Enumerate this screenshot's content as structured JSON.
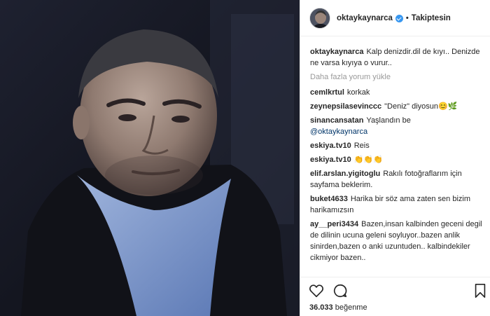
{
  "header": {
    "username": "oktaykaynarca",
    "separator": "•",
    "follow_status": "Takiptesin",
    "icons": {
      "verified": "verified-badge-icon"
    }
  },
  "caption": {
    "username": "oktaykaynarca",
    "text": "Kalp denizdir.dil de kıyı.. Denizde ne varsa kıyıya o vurur.."
  },
  "load_more": "Daha fazla yorum yükle",
  "comments": [
    {
      "username": "cemlkrtul",
      "text": "korkak"
    },
    {
      "username": "zeynepsilasevinccc",
      "text": "\"Deniz\" diyosun😊🌿"
    },
    {
      "username": "sinancansatan",
      "text": "Yaşlandın be",
      "mention": "@oktaykaynarca"
    },
    {
      "username": "eskiya.tv10",
      "text": "Reis"
    },
    {
      "username": "eskiya.tv10",
      "text": "👏👏👏"
    },
    {
      "username": "elif.arslan.yigitoglu",
      "text": "Rakılı fotoğraflarım için sayfama beklerim."
    },
    {
      "username": "buket4633",
      "text": "Harika bir söz ama zaten sen bizim harikamızsın"
    },
    {
      "username": "ay__peri3434",
      "text": "Bazen,insan kalbinden geceni degil de dilinin ucuna geleni soyluyor..bazen anlik sinirden,bazen o anki uzuntuden.. kalbindekiler cikmiyor bazen.."
    }
  ],
  "actions": {
    "like_icon": "heart-icon",
    "comment_icon": "comment-icon",
    "save_icon": "bookmark-icon"
  },
  "likes": {
    "count": "36.033",
    "label": "beğenme"
  },
  "colors": {
    "verified": "#3897f0",
    "border": "#efefef",
    "muted": "#999999",
    "mention": "#003569"
  }
}
